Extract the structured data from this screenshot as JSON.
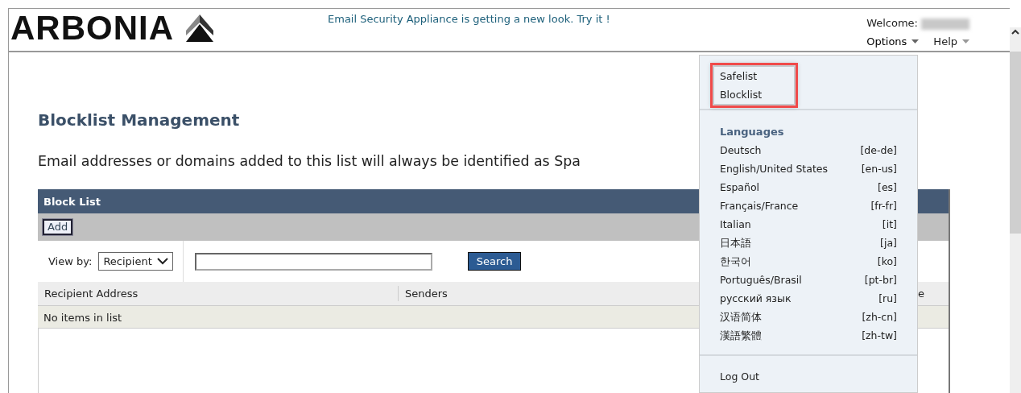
{
  "header": {
    "logo": "ARBONIA",
    "banner_link": "Email Security Appliance is getting a new look. Try it !",
    "welcome_label": "Welcome:",
    "menus": [
      {
        "label": "Options",
        "expanded": true
      },
      {
        "label": "Help",
        "expanded": false
      }
    ]
  },
  "page": {
    "title": "Blocklist Management",
    "description": "Email addresses or domains added to this list will always be identified as Spa"
  },
  "panel": {
    "title": "Block List",
    "add_button": "Add",
    "view_by_label": "View by:",
    "view_by_value": "Recipient",
    "search_button": "Search",
    "columns": [
      "Recipient Address",
      "Senders",
      "e"
    ],
    "empty_message": "No items in list"
  },
  "options_menu": {
    "groups": [
      {
        "kind": "links",
        "highlighted": true,
        "items": [
          "Safelist",
          "Blocklist"
        ]
      },
      {
        "kind": "languages",
        "heading": "Languages",
        "items": [
          {
            "name": "Deutsch",
            "code": "[de-de]"
          },
          {
            "name": "English/United States",
            "code": "[en-us]"
          },
          {
            "name": "Español",
            "code": "[es]"
          },
          {
            "name": "Français/France",
            "code": "[fr-fr]"
          },
          {
            "name": "Italian",
            "code": "[it]"
          },
          {
            "name": "日本語",
            "code": "[ja]"
          },
          {
            "name": "한국어",
            "code": "[ko]"
          },
          {
            "name": "Português/Brasil",
            "code": "[pt-br]"
          },
          {
            "name": "русский язык",
            "code": "[ru]"
          },
          {
            "name": "汉语简体",
            "code": "[zh-cn]"
          },
          {
            "name": "漢語繁體",
            "code": "[zh-tw]"
          }
        ]
      },
      {
        "kind": "links",
        "highlighted": false,
        "items": [
          "Log Out"
        ]
      }
    ]
  }
}
